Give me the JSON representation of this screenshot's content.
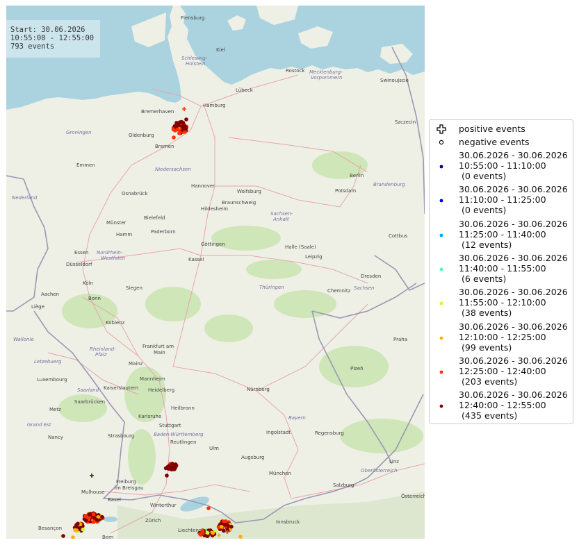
{
  "info": {
    "line1": "Start: 30.06.2026",
    "line2": "10:55:00 - 12:55:00",
    "line3": "793 events"
  },
  "legend": {
    "positive": "positive events",
    "negative": "negative events",
    "bins": [
      {
        "line1": "30.06.2026 - 30.06.2026",
        "line2": "10:55:00 - 11:10:00",
        "line3": " (0 events)",
        "color": "#000080"
      },
      {
        "line1": "30.06.2026 - 30.06.2026",
        "line2": "11:10:00 - 11:25:00",
        "line3": " (0 events)",
        "color": "#0000e8"
      },
      {
        "line1": "30.06.2026 - 30.06.2026",
        "line2": "11:25:00 - 11:40:00",
        "line3": " (12 events)",
        "color": "#00a4ff"
      },
      {
        "line1": "30.06.2026 - 30.06.2026",
        "line2": "11:40:00 - 11:55:00",
        "line3": " (6 events)",
        "color": "#4dffaa"
      },
      {
        "line1": "30.06.2026 - 30.06.2026",
        "line2": "11:55:00 - 12:10:00",
        "line3": " (38 events)",
        "color": "#c4ff36"
      },
      {
        "line1": "30.06.2026 - 30.06.2026",
        "line2": "12:10:00 - 12:25:00",
        "line3": " (99 events)",
        "color": "#ffb000"
      },
      {
        "line1": "30.06.2026 - 30.06.2026",
        "line2": "12:25:00 - 12:40:00",
        "line3": " (203 events)",
        "color": "#ff3000"
      },
      {
        "line1": "30.06.2026 - 30.06.2026",
        "line2": "12:40:00 - 12:55:00",
        "line3": " (435 events)",
        "color": "#800000"
      }
    ]
  },
  "map": {
    "land_color": "#eef0e6",
    "water_color": "#aad3df",
    "places": [
      "Flensburg",
      "Kiel",
      "Schleswig-Holstein",
      "Rostock",
      "Mecklenburg-Vorpommern",
      "Lübeck",
      "Hamburg",
      "Bremerhaven",
      "Swinoujscie",
      "Szczecin",
      "Oldenburg",
      "Bremen",
      "Groningen",
      "Emmen",
      "Niedersachsen",
      "Hannover",
      "Wolfsburg",
      "Braunschweig",
      "Berlin",
      "Brandenburg",
      "Nederland",
      "Osnabrück",
      "Hildesheim",
      "Sachsen-Anhalt",
      "Bielefeld",
      "Paderborn",
      "Münster",
      "Potsdam",
      "Hamm",
      "Cottbus",
      "Essen",
      "Nordrhein-Westfalen",
      "Düsseldorf",
      "Göttingen",
      "Halle (Saale)",
      "Leipzig",
      "Kassel",
      "Köln",
      "Dresden",
      "Siegen",
      "Bonn",
      "Thüringen",
      "Chemnitz",
      "Sachsen",
      "Aachen",
      "Liège",
      "Koblenz",
      "Praha",
      "Wallonie",
      "Frankfurt am Main",
      "Rheinland-Pfalz",
      "Letzebuerg",
      "Luxembourg",
      "Mainz",
      "Plzeň",
      "Saarland",
      "Mannheim",
      "Nürnberg",
      "Kaiserslautern",
      "Heidelberg",
      "Metz",
      "Saarbrücken",
      "Heilbronn",
      "Grand Est",
      "Karlsruhe",
      "Bayern",
      "Regensburg",
      "Stuttgart",
      "Ingolstadt",
      "Strasbourg",
      "Baden-Württemberg",
      "Reutlingen",
      "Nancy",
      "Ulm",
      "Augsburg",
      "Linz",
      "München",
      "Freiburg im Breisgau",
      "Oberösterreich",
      "Mulhouse",
      "Salzburg",
      "Basel",
      "Winterthur",
      "Zürich",
      "Liechtenstein",
      "Innsbruck",
      "Bern",
      "Besançon",
      "Österreich"
    ]
  }
}
